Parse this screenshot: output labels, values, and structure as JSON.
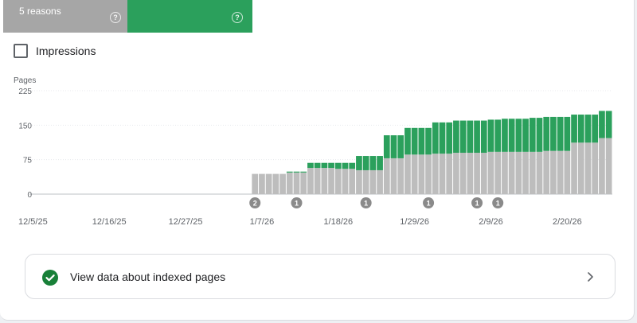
{
  "tabs": {
    "not_indexed": {
      "label": "5 reasons",
      "help": "?"
    },
    "indexed": {
      "help": "?"
    }
  },
  "impressions": {
    "label": "Impressions",
    "checked": false
  },
  "colors": {
    "not_indexed": "#bdbdbd",
    "indexed": "#2ba05c",
    "annotation": "#8a8a8a"
  },
  "icons": [
    "help-icon",
    "checkbox-icon",
    "check-circle-icon",
    "chevron-right-icon"
  ],
  "link": {
    "label": "View data about indexed pages"
  },
  "chart_data": {
    "type": "bar",
    "stacked": true,
    "ylabel": "Pages",
    "ylim": [
      0,
      225
    ],
    "yticks": [
      0,
      75,
      150,
      225
    ],
    "xticks": [
      "12/5/25",
      "12/16/25",
      "12/27/25",
      "1/7/26",
      "1/18/26",
      "1/29/26",
      "2/9/26",
      "2/20/26"
    ],
    "grid": true,
    "x": [
      "1/6/26",
      "1/7/26",
      "1/8/26",
      "1/9/26",
      "1/10/26",
      "1/11/26",
      "1/12/26",
      "1/13/26",
      "1/14/26",
      "1/15/26",
      "1/16/26",
      "1/17/26",
      "1/18/26",
      "1/19/26",
      "1/20/26",
      "1/21/26",
      "1/22/26",
      "1/23/26",
      "1/24/26",
      "1/25/26",
      "1/26/26",
      "1/27/26",
      "1/28/26",
      "1/29/26",
      "1/30/26",
      "1/31/26",
      "2/1/26",
      "2/2/26",
      "2/3/26",
      "2/4/26",
      "2/5/26",
      "2/6/26",
      "2/7/26",
      "2/8/26",
      "2/9/26",
      "2/10/26",
      "2/11/26",
      "2/12/26",
      "2/13/26",
      "2/14/26",
      "2/15/26",
      "2/16/26",
      "2/17/26",
      "2/18/26",
      "2/19/26",
      "2/20/26",
      "2/21/26",
      "2/22/26",
      "2/23/26",
      "2/24/26",
      "2/25/26",
      "2/26/26"
    ],
    "series": [
      {
        "values": [
          44,
          44,
          44,
          44,
          44,
          47,
          47,
          47,
          57,
          57,
          57,
          57,
          55,
          55,
          55,
          52,
          52,
          52,
          52,
          78,
          78,
          78,
          86,
          86,
          86,
          86,
          88,
          88,
          88,
          90,
          90,
          90,
          90,
          90,
          92,
          92,
          92,
          92,
          92,
          92,
          92,
          92,
          94,
          94,
          94,
          94,
          112,
          112,
          112,
          112,
          122,
          122
        ]
      },
      {
        "values": [
          0,
          0,
          0,
          0,
          0,
          2,
          2,
          2,
          11,
          11,
          11,
          11,
          13,
          13,
          13,
          31,
          31,
          31,
          31,
          50,
          50,
          50,
          58,
          58,
          58,
          58,
          68,
          68,
          68,
          70,
          70,
          70,
          70,
          70,
          70,
          70,
          72,
          72,
          72,
          72,
          74,
          74,
          74,
          74,
          74,
          74,
          61,
          61,
          61,
          61,
          59,
          59
        ]
      }
    ],
    "annotations": [
      {
        "x": "1/6/26",
        "label": "2"
      },
      {
        "x": "1/12/26",
        "label": "1"
      },
      {
        "x": "1/22/26",
        "label": "1"
      },
      {
        "x": "1/31/26",
        "label": "1"
      },
      {
        "x": "2/7/26",
        "label": "1"
      },
      {
        "x": "2/10/26",
        "label": "1"
      }
    ]
  }
}
